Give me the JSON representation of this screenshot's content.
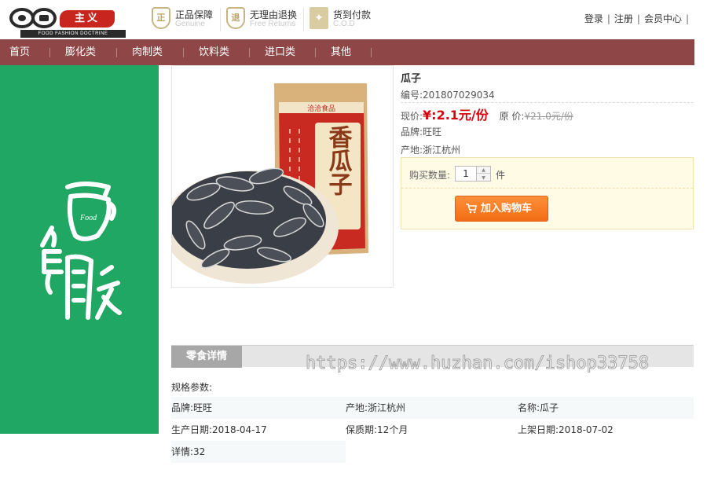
{
  "header": {
    "logo_sub": "FOOD FASHION DOCTRINE",
    "logo_red_text": "主义",
    "promises": [
      {
        "badge": "正",
        "title": "正品保障",
        "subtitle": "Genuine"
      },
      {
        "badge": "退",
        "title": "无理由退换",
        "subtitle": "Free Returns"
      },
      {
        "badge": "✦",
        "title": "货到付款",
        "subtitle": "C.O.D"
      }
    ],
    "links": {
      "login": "登录",
      "register": "注册",
      "member": "会员中心"
    },
    "separator": "|"
  },
  "nav": {
    "items": [
      "首页",
      "膨化类",
      "肉制类",
      "饮料类",
      "进口类",
      "其他"
    ]
  },
  "product": {
    "name": "瓜子",
    "code": "编号:201807029034",
    "price_label": "现价:",
    "price": "¥:2.1元/份",
    "original_label": "原 价:",
    "original_price": "¥21.0元/份",
    "brand": "品牌:旺旺",
    "origin": "产地:浙江杭州",
    "package_brand": "洽洽食品",
    "package_title": "香瓜子"
  },
  "purchase": {
    "qty_label": "购买数量:",
    "qty_value": "1",
    "unit": "件",
    "cart_label": "加入购物车"
  },
  "detail": {
    "tab": "零食详情",
    "watermark": "https://www.huzhan.com/ishop33758",
    "spec_title": "规格参数:",
    "rows": [
      [
        "品牌:旺旺",
        "产地:浙江杭州",
        "名称:瓜子"
      ],
      [
        "生产日期:2018-04-17",
        "保质期:12个月",
        "上架日期:2018-07-02"
      ]
    ],
    "last": "详情:32"
  },
  "colors": {
    "nav_bg": "#8e4646",
    "banner_bg": "#20a764",
    "price": "#d6000f",
    "cart_button": "#f57a20"
  }
}
